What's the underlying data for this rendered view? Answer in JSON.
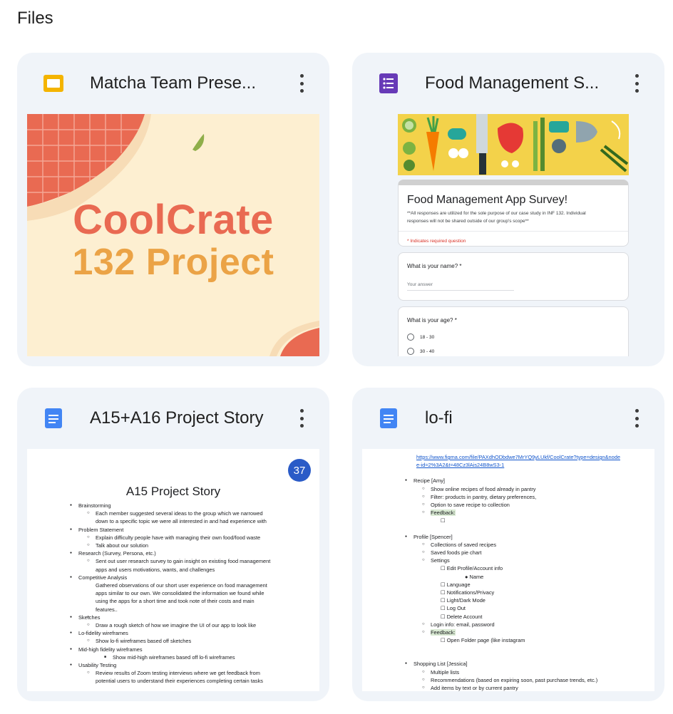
{
  "section": {
    "title": "Files"
  },
  "files": [
    {
      "name": "Matcha Team Prese...",
      "type_icon": "slides-icon",
      "thumb": {
        "line1": "CoolCrate",
        "line2": "132 Project"
      }
    },
    {
      "name": "Food Management S...",
      "type_icon": "forms-icon",
      "thumb": {
        "title": "Food Management App Survey!",
        "note1": "**All responses are utilized for the sole purpose of our case study in INF 132. Individual",
        "note2": "responses will not be shared outside of our group's scope**",
        "required": "* Indicates required question",
        "q1": "What is your name? *",
        "q1_placeholder": "Your answer",
        "q2": "What is your age? *",
        "q2_options": [
          "18 - 30",
          "30 - 40"
        ]
      }
    },
    {
      "name": "A15+A16 Project Story",
      "type_icon": "docs-icon",
      "thumb": {
        "badge": "37",
        "heading": "A15 Project Story",
        "lines": [
          "Brainstorming",
          "Each member suggested several ideas to the group which we narrowed",
          "down to a specific topic we were all interested in and had experience with",
          "Problem Statement",
          "Explain difficulty people have with managing their own food/food waste",
          "Talk about our solution",
          "Research (Survey, Persona, etc.)",
          "Sent out user research survey to gain insight on existing food management",
          "apps and users motivations, wants, and challenges",
          "Competitive Analysis",
          "Gathered observations of our short user experience on food management",
          "apps similar to our own. We consolidated the information we found while",
          "using the apps for a short time and took note of their costs and main",
          "features..",
          "Sketches",
          "Draw a rough sketch of how we imagine the UI of our app to look like",
          "Lo-fidelity wireframes",
          "Show lo-fi wireframes based off sketches",
          "Mid-high fidelity wireframes",
          "Show mid-high  wireframes based off lo-fi wireframes",
          "Usability Testing",
          "Review results of Zoom testing interviews where we get feedback from",
          "potential users to understand their experiences completing certain tasks"
        ]
      }
    },
    {
      "name": "lo-fi",
      "type_icon": "docs-icon",
      "thumb": {
        "link1": "https://www.figma.com/file/PAXdhODbdwe7MrYQ9yLUkf/CoolCrate?type=design&node",
        "link2": "e-id=2%3A2&t=48Cz3lAis24B8wS3-1",
        "lines": [
          "Recipe [Amy]",
          "Show online recipes of food already in pantry",
          "Filter: products in pantry, dietary preferences,",
          "Option to save recipe to collection",
          "Feedback:",
          "Profile [Spencer]",
          "Collections of saved recipes",
          "Saved foods pie chart",
          "Settings",
          "Edit Profile/Account info",
          "Name",
          "Language",
          "Notifications/Privacy",
          "Light/Dark Mode",
          "Log Out",
          "Delete Account",
          "Login info: email, password",
          "Feedback:",
          "Open Folder page (like instagram",
          "Shopping List [Jessica]",
          "Multiple lists",
          "Recommendations (based on expiring soon, past purchase trends, etc.)",
          "Add items by text or by current pantry"
        ]
      }
    }
  ],
  "colors": {
    "card_bg": "#f0f4f9",
    "slides": "#f4b400",
    "forms": "#673ab7",
    "docs": "#4285f4",
    "coral": "#e96a52",
    "orange": "#eba346"
  }
}
